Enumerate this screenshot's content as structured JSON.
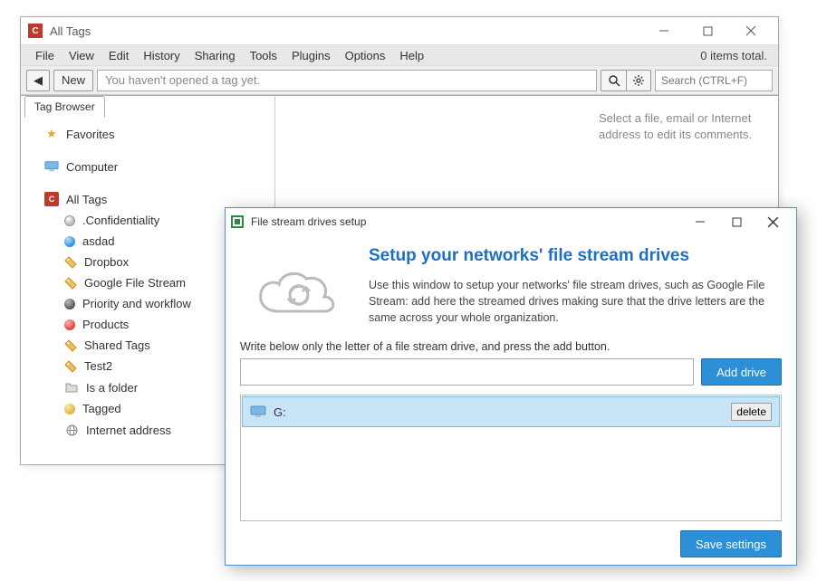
{
  "mainWindow": {
    "title": "All Tags",
    "menubar": [
      "File",
      "View",
      "Edit",
      "History",
      "Sharing",
      "Tools",
      "Plugins",
      "Options",
      "Help"
    ],
    "itemsTotal": "0 items total.",
    "toolbar": {
      "backLabel": "◀",
      "newLabel": "New",
      "addressPlaceholder": "You haven't opened a tag yet.",
      "searchPlaceholder": "Search (CTRL+F)"
    },
    "tab": "Tag Browser",
    "tree": {
      "favorites": "Favorites",
      "computer": "Computer",
      "allTags": "All Tags",
      "children": [
        {
          "label": ".Confidentiality",
          "iconClass": "dot dot-gray"
        },
        {
          "label": "asdad",
          "iconClass": "dot dot-blue"
        },
        {
          "label": "Dropbox",
          "iconClass": "tag-icon",
          "svg": "tag"
        },
        {
          "label": "Google File Stream",
          "iconClass": "tag-icon",
          "svg": "tag"
        },
        {
          "label": "Priority and workflow",
          "iconClass": "dot dot-dark"
        },
        {
          "label": "Products",
          "iconClass": "dot dot-red"
        },
        {
          "label": "Shared Tags",
          "iconClass": "tag-icon",
          "svg": "tag"
        },
        {
          "label": "Test2",
          "iconClass": "tag-icon",
          "svg": "tag"
        },
        {
          "label": "Is a folder",
          "iconClass": "folder-icon",
          "svg": "folder"
        },
        {
          "label": "Tagged",
          "iconClass": "dot dot-yellow"
        },
        {
          "label": "Internet address",
          "iconClass": "globe-icon",
          "svg": "globe"
        }
      ]
    },
    "rightPanelText": "Select a file, email or Internet address to edit its comments."
  },
  "modal": {
    "title": "File stream drives setup",
    "heading": "Setup your networks' file stream drives",
    "description": "Use this window to setup your networks' file stream drives, such as Google File Stream: add here the streamed drives making sure that the drive letters  are the same across your whole organization.",
    "instruction": "Write below only the letter of a file stream drive, and press the add button.",
    "addDriveLabel": "Add drive",
    "drives": [
      {
        "letter": "G:",
        "deleteLabel": "delete"
      }
    ],
    "saveLabel": "Save settings"
  }
}
